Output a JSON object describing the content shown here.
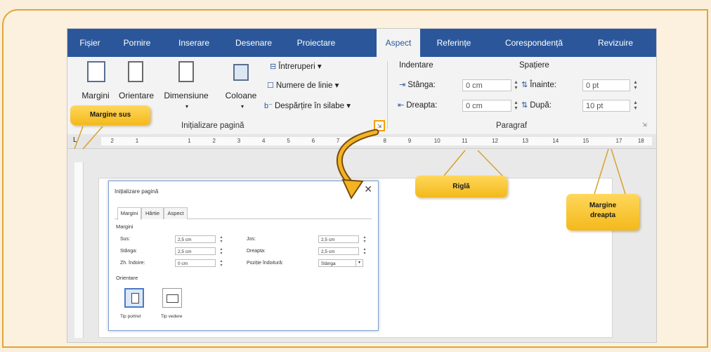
{
  "tabs": [
    {
      "label": "Fișier"
    },
    {
      "label": "Pornire"
    },
    {
      "label": "Inserare"
    },
    {
      "label": "Desenare"
    },
    {
      "label": "Proiectare"
    },
    {
      "label": "Aspect"
    },
    {
      "label": "Referințe"
    },
    {
      "label": "Corespondență"
    },
    {
      "label": "Revizuire"
    }
  ],
  "ribbon": {
    "margini": "Margini",
    "orientare": "Orientare",
    "dimensiune": "Dimensiune",
    "coloane": "Coloane",
    "intreruperi": "Întreruperi",
    "numere_linie": "Numere de linie",
    "despartire": "Despărțire în silabe",
    "group_page": "Inițializare pagină",
    "indentare": "Indentare",
    "spatiere": "Spațiere",
    "stanga_label": "Stânga:",
    "stanga_value": "0 cm",
    "dreapta_label": "Dreapta:",
    "dreapta_value": "0 cm",
    "inainte_label": "Înainte:",
    "inainte_value": "0 pt",
    "dupa_label": "După:",
    "dupa_value": "10 pt",
    "group_paragraf": "Paragraf"
  },
  "ruler": {
    "ticks": [
      "2",
      "1",
      "1",
      "2",
      "3",
      "4",
      "5",
      "6",
      "7",
      "8",
      "9",
      "10",
      "11",
      "12",
      "13",
      "14",
      "15",
      "17",
      "18"
    ]
  },
  "dialog": {
    "title": "Inițializare pagină",
    "tabs": [
      "Margini",
      "Hârtie",
      "Aspect"
    ],
    "section_margini": "Margini",
    "sus_label": "Sus:",
    "sus_value": "2,5 cm",
    "jos_label": "Jos:",
    "jos_value": "2,5 cm",
    "stanga_label": "Stânga:",
    "stanga_value": "2,5 cm",
    "dreapta_label": "Dreapta:",
    "dreapta_value": "2,5 cm",
    "indoire_label": "Zh. îndoire:",
    "indoire_value": "0 cm",
    "pozitie_label": "Poziție îndoitură:",
    "pozitie_value": "Stânga",
    "section_orientare": "Orientare",
    "portret": "Tip portret",
    "vedere": "Tip vedere"
  },
  "callouts": {
    "margine_sus": "Margine sus",
    "rigla": "Riglă",
    "margine_dreapta_1": "Margine",
    "margine_dreapta_2": "dreapta"
  },
  "colors": {
    "tab_bar": "#2b579a",
    "callout": "#f5c22e",
    "card_border": "#e0a537",
    "card_bg": "#fcf1de"
  }
}
